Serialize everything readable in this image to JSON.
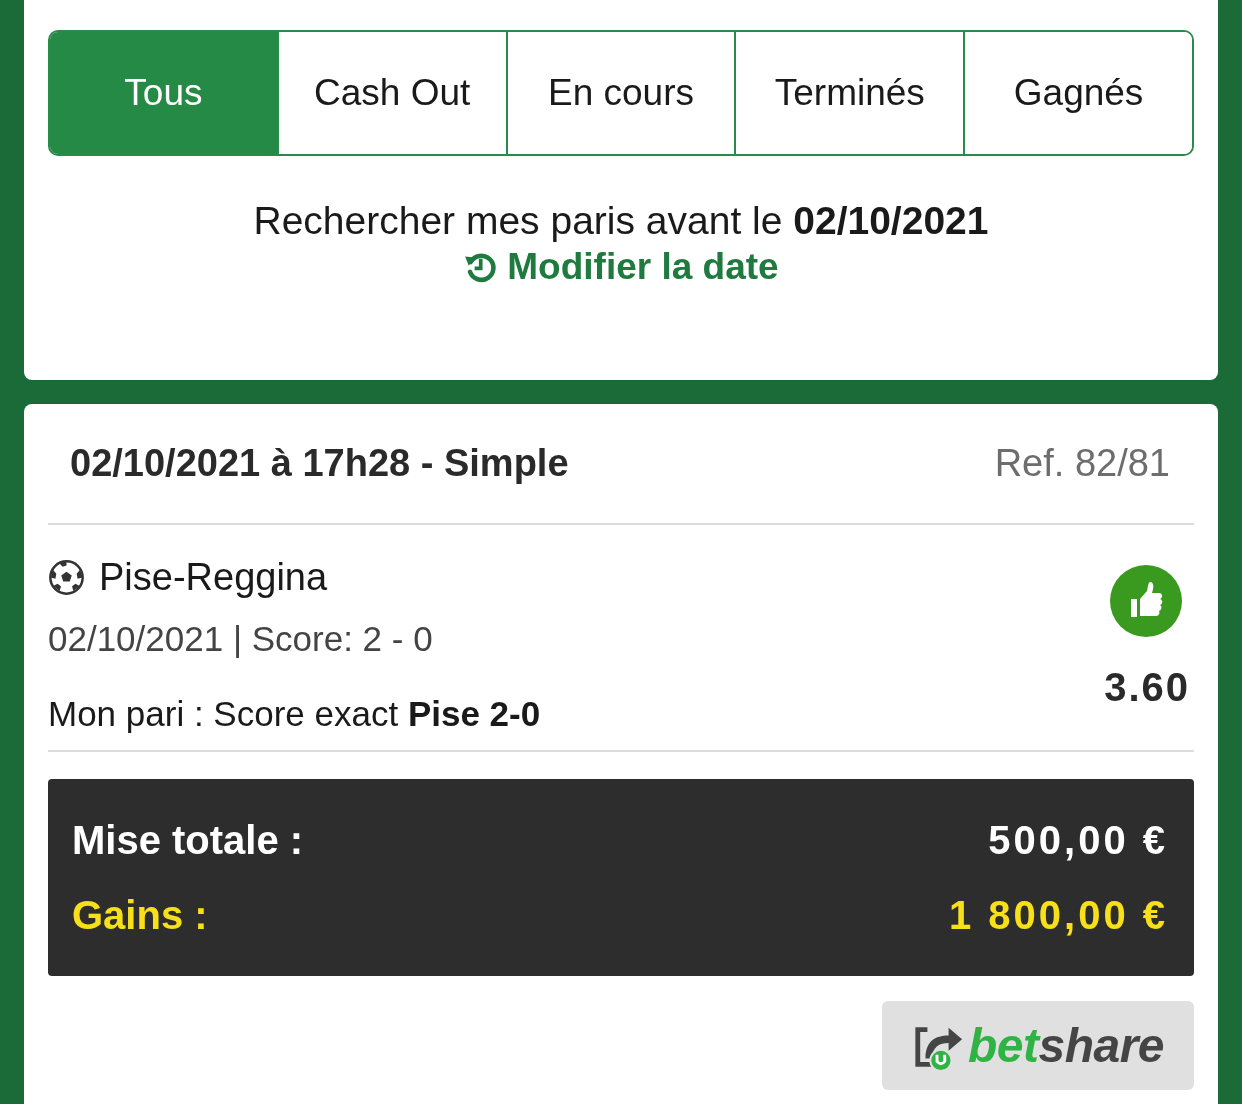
{
  "tabs": [
    {
      "label": "Tous",
      "selected": true
    },
    {
      "label": "Cash Out",
      "selected": false
    },
    {
      "label": "En cours",
      "selected": false
    },
    {
      "label": "Terminés",
      "selected": false
    },
    {
      "label": "Gagnés",
      "selected": false
    }
  ],
  "search": {
    "text": "Rechercher mes paris avant le **02/10/2021**",
    "link": "Modifier la date"
  },
  "bet": {
    "title": "02/10/2021 à 17h28 - Simple",
    "ref": "Ref. 82/81",
    "selection": {
      "match": "Pise-Reggina",
      "details": "02/10/2021 | Score: 2 - 0",
      "pick": "Mon pari : Score exact **Pise 2-0**",
      "won": true,
      "odds": "3.60"
    },
    "summary": [
      {
        "kind": "stake",
        "label": "Mise totale :",
        "value": "500,00 €"
      },
      {
        "kind": "winnings",
        "label": "Gains :",
        "value": "1 800,00 €"
      }
    ]
  },
  "share_button": {
    "parts": [
      {
        "text": "bet",
        "color": "#2fb344"
      },
      {
        "text": "share",
        "color": "#454545"
      }
    ]
  }
}
